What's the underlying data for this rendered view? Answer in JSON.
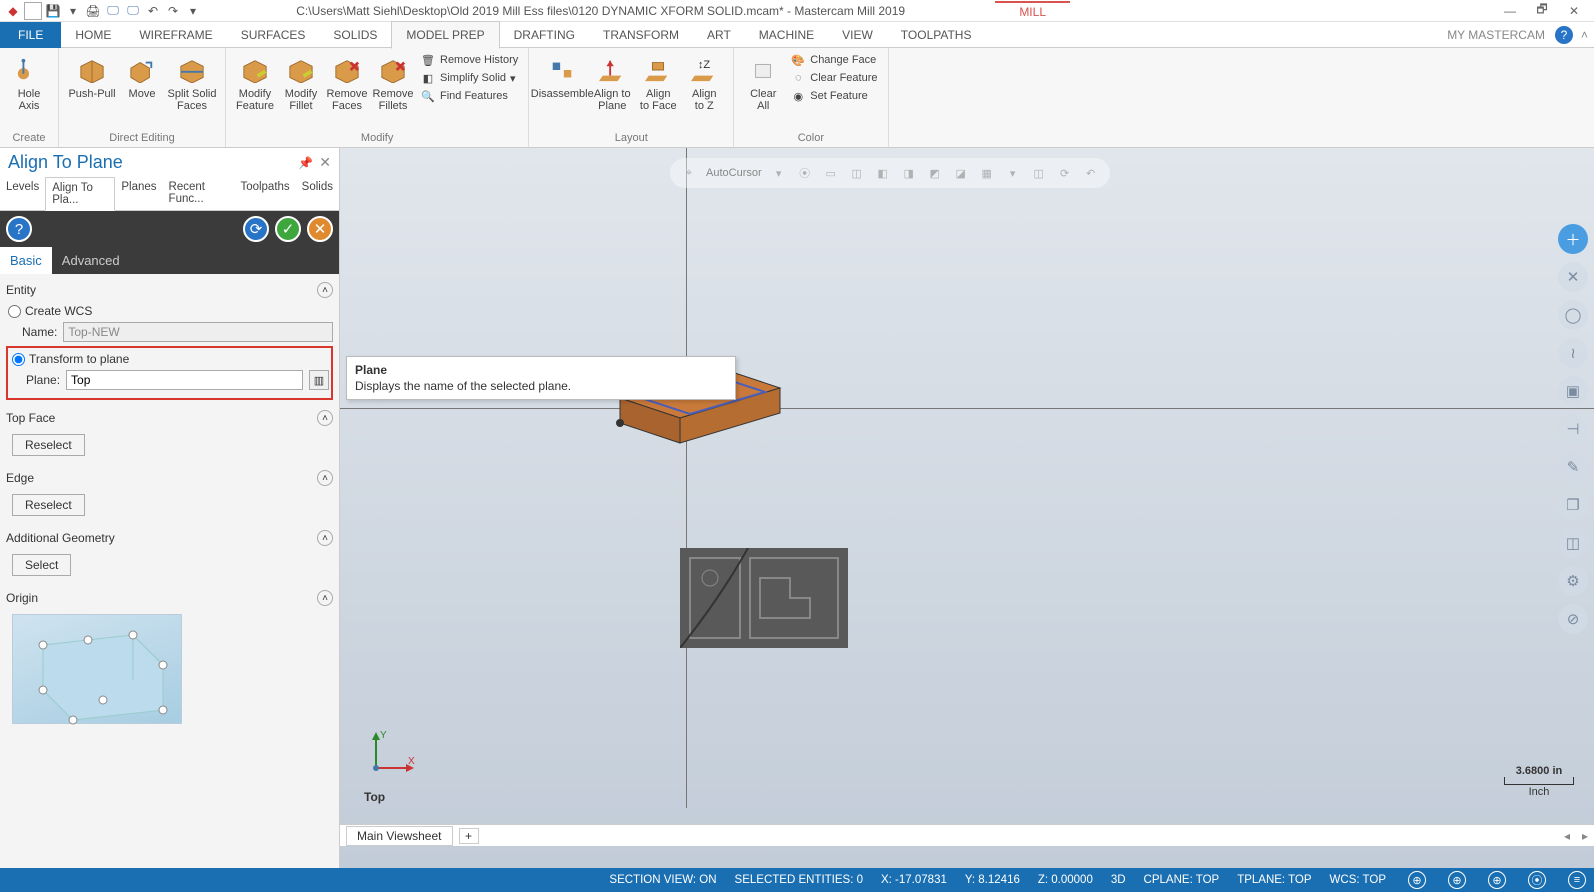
{
  "title_bar": {
    "path": "C:\\Users\\Matt Siehl\\Desktop\\Old 2019 Mill Ess files\\0120 DYNAMIC XFORM SOLID.mcam* - Mastercam Mill 2019",
    "context_tab": "MILL"
  },
  "ribbon": {
    "file": "FILE",
    "right_label": "MY MASTERCAM",
    "tabs": [
      "HOME",
      "WIREFRAME",
      "SURFACES",
      "SOLIDS",
      "MODEL PREP",
      "DRAFTING",
      "TRANSFORM",
      "ART",
      "MACHINE",
      "VIEW",
      "TOOLPATHS"
    ],
    "active_tab": "MODEL PREP",
    "groups": {
      "create": {
        "label": "Create",
        "hole_axis": "Hole\nAxis"
      },
      "direct": {
        "label": "Direct Editing",
        "push_pull": "Push-Pull",
        "move": "Move",
        "split": "Split Solid\nFaces"
      },
      "modify": {
        "label": "Modify",
        "mfeature": "Modify\nFeature",
        "mfillet": "Modify\nFillet",
        "rfaces": "Remove\nFaces",
        "rfillets": "Remove\nFillets",
        "remove_history": "Remove History",
        "simplify": "Simplify Solid",
        "find": "Find Features"
      },
      "layout": {
        "label": "Layout",
        "disassemble": "Disassemble",
        "align_plane": "Align to\nPlane",
        "align_face": "Align\nto Face",
        "align_z": "Align\nto Z"
      },
      "color": {
        "label": "Color",
        "clear_all": "Clear\nAll",
        "change_face": "Change Face",
        "clear_feature": "Clear Feature",
        "set_feature": "Set Feature"
      }
    }
  },
  "left_panel": {
    "title": "Align To Plane",
    "tabs": [
      "Levels",
      "Align To Pla...",
      "Planes",
      "Recent Func...",
      "Toolpaths",
      "Solids"
    ],
    "active_tab": "Align To Pla...",
    "subtabs": {
      "basic": "Basic",
      "advanced": "Advanced"
    },
    "entity": {
      "header": "Entity",
      "create_wcs": "Create WCS",
      "name_label": "Name:",
      "name_value": "Top-NEW",
      "transform": "Transform to plane",
      "plane_label": "Plane:",
      "plane_value": "Top"
    },
    "top_face": {
      "header": "Top Face",
      "reselect": "Reselect"
    },
    "edge": {
      "header": "Edge",
      "reselect": "Reselect"
    },
    "additional": {
      "header": "Additional Geometry",
      "select": "Select"
    },
    "origin": {
      "header": "Origin"
    }
  },
  "tooltip": {
    "title": "Plane",
    "body": "Displays the name of the selected plane."
  },
  "canvas": {
    "float_label": "AutoCursor",
    "view_label": "Top",
    "scale_value": "3.6800 in",
    "scale_unit": "Inch",
    "viewsheet": "Main Viewsheet"
  },
  "status": {
    "section": "SECTION VIEW: ON",
    "selected": "SELECTED ENTITIES: 0",
    "x": "X:   -17.07831",
    "y": "Y:    8.12416",
    "z": "Z:   0.00000",
    "mode": "3D",
    "cplane": "CPLANE: TOP",
    "tplane": "TPLANE: TOP",
    "wcs": "WCS: TOP"
  }
}
